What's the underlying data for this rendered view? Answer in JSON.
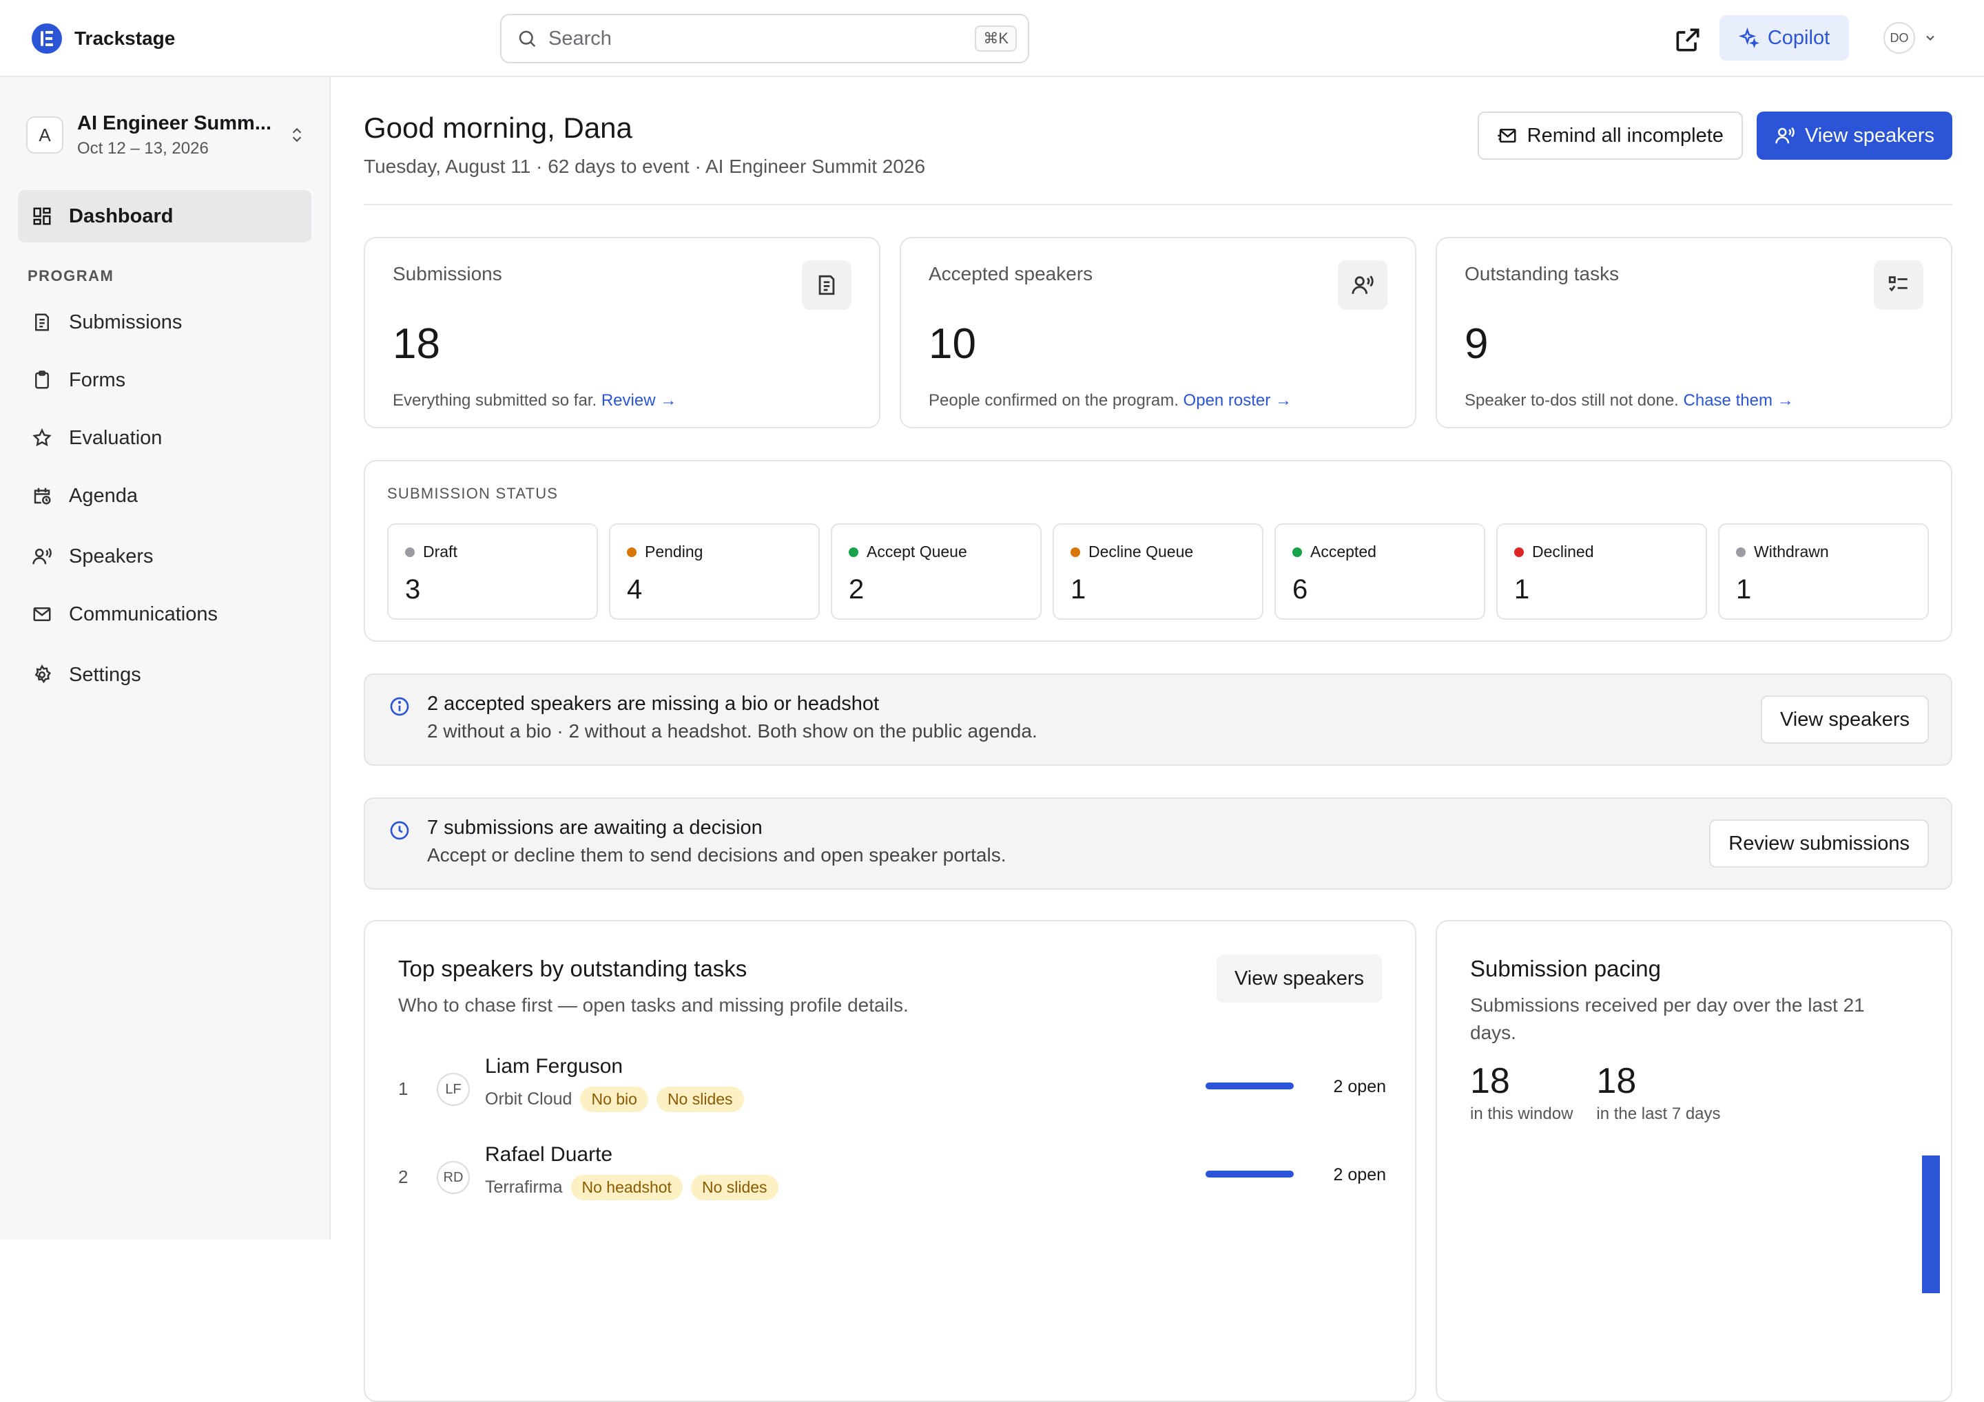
{
  "app": {
    "name": "Trackstage"
  },
  "search": {
    "placeholder": "Search",
    "shortcut": "⌘K"
  },
  "topbar": {
    "copilot_label": "Copilot",
    "user_initials": "DO"
  },
  "event": {
    "badge": "A",
    "name": "AI Engineer Summ...",
    "dates": "Oct 12 – 13, 2026"
  },
  "sidebar": {
    "dashboard": "Dashboard",
    "section": "PROGRAM",
    "items": [
      {
        "label": "Submissions",
        "icon": "document-list-icon"
      },
      {
        "label": "Forms",
        "icon": "clipboard-icon"
      },
      {
        "label": "Evaluation",
        "icon": "star-icon"
      },
      {
        "label": "Agenda",
        "icon": "calendar-clock-icon"
      },
      {
        "label": "Speakers",
        "icon": "speaker-icon"
      },
      {
        "label": "Communications",
        "icon": "mail-icon"
      },
      {
        "label": "Settings",
        "icon": "gear-icon"
      }
    ]
  },
  "header": {
    "greeting": "Good morning, Dana",
    "subtitle": "Tuesday, August 11 · 62 days to event · AI Engineer Summit 2026",
    "remind_label": "Remind all incomplete",
    "view_speakers_label": "View speakers"
  },
  "stats": [
    {
      "label": "Submissions",
      "value": "18",
      "desc": "Everything submitted so far.",
      "link": "Review →",
      "icon": "document-icon"
    },
    {
      "label": "Accepted speakers",
      "value": "10",
      "desc": "People confirmed on the program.",
      "link": "Open roster →",
      "icon": "speaker-icon"
    },
    {
      "label": "Outstanding tasks",
      "value": "9",
      "desc": "Speaker to-dos still not done.",
      "link": "Chase them →",
      "icon": "checklist-icon"
    }
  ],
  "submission_status": {
    "title": "SUBMISSION STATUS",
    "items": [
      {
        "label": "Draft",
        "value": "3",
        "color": "#9b9ba1"
      },
      {
        "label": "Pending",
        "value": "4",
        "color": "#d97706"
      },
      {
        "label": "Accept Queue",
        "value": "2",
        "color": "#16a34a"
      },
      {
        "label": "Decline Queue",
        "value": "1",
        "color": "#d97706"
      },
      {
        "label": "Accepted",
        "value": "6",
        "color": "#16a34a"
      },
      {
        "label": "Declined",
        "value": "1",
        "color": "#dc2626"
      },
      {
        "label": "Withdrawn",
        "value": "1",
        "color": "#9b9ba1"
      }
    ]
  },
  "alerts": [
    {
      "title": "2 accepted speakers are missing a bio or headshot",
      "desc": "2 without a bio · 2 without a headshot. Both show on the public agenda.",
      "button": "View speakers",
      "icon": "info-icon"
    },
    {
      "title": "7 submissions are awaiting a decision",
      "desc": "Accept or decline them to send decisions and open speaker portals.",
      "button": "Review submissions",
      "icon": "clock-icon"
    }
  ],
  "top_speakers": {
    "title": "Top speakers by outstanding tasks",
    "desc": "Who to chase first — open tasks and missing profile details.",
    "button": "View speakers",
    "rows": [
      {
        "rank": "1",
        "initials": "LF",
        "name": "Liam Ferguson",
        "org": "Orbit Cloud",
        "tags": [
          "No bio",
          "No slides"
        ],
        "open": "2 open",
        "progress": 1.0
      },
      {
        "rank": "2",
        "initials": "RD",
        "name": "Rafael Duarte",
        "org": "Terrafirma",
        "tags": [
          "No headshot",
          "No slides"
        ],
        "open": "2 open",
        "progress": 1.0
      }
    ]
  },
  "pacing": {
    "title": "Submission pacing",
    "desc": "Submissions received per day over the last 21 days.",
    "window_value": "18",
    "window_label": "in this window",
    "week_value": "18",
    "week_label": "in the last 7 days"
  },
  "colors": {
    "accent": "#2b55d6",
    "tag_bg": "#fdf0c4",
    "tag_text": "#8a5a00"
  }
}
